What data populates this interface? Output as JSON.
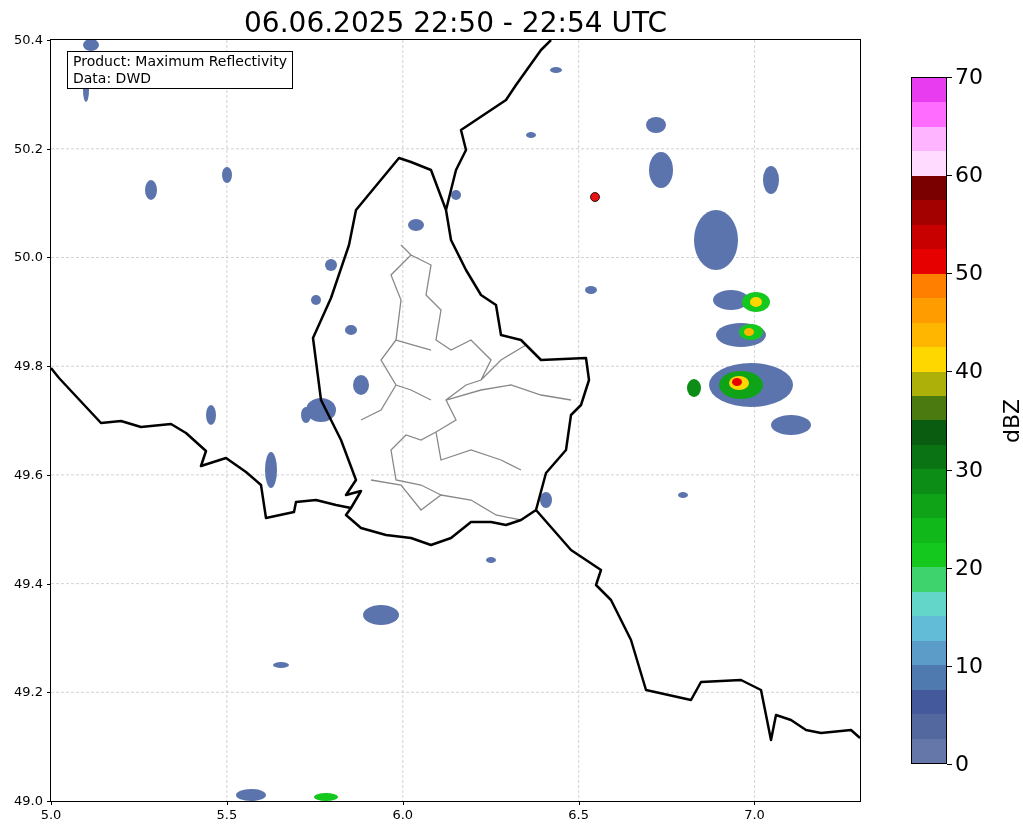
{
  "title": "06.06.2025 22:50 - 22:54 UTC",
  "legend": [
    "Product: Maximum Reflectivity",
    "Data: DWD"
  ],
  "x_ticks": [
    "5.0",
    "5.5",
    "6.0",
    "6.5",
    "7.0"
  ],
  "y_ticks": [
    "50.4",
    "50.2",
    "50.0",
    "49.8",
    "49.6",
    "49.4",
    "49.2",
    "49.0"
  ],
  "colorbar": {
    "label": "dBZ",
    "ticks": [
      "70",
      "60",
      "50",
      "40",
      "30",
      "20",
      "10",
      "0"
    ],
    "bands": [
      {
        "color": "#6577a8"
      },
      {
        "color": "#5468a0"
      },
      {
        "color": "#44599c"
      },
      {
        "color": "#4e7ab0"
      },
      {
        "color": "#5b9cc8"
      },
      {
        "color": "#62bcd8"
      },
      {
        "color": "#63d6c9"
      },
      {
        "color": "#3fd36e"
      },
      {
        "color": "#14c81e"
      },
      {
        "color": "#10b81a"
      },
      {
        "color": "#0fa418"
      },
      {
        "color": "#0c8e16"
      },
      {
        "color": "#0a7414"
      },
      {
        "color": "#095c10"
      },
      {
        "color": "#4a7a10"
      },
      {
        "color": "#aeb00a"
      },
      {
        "color": "#ffd700"
      },
      {
        "color": "#ffb600"
      },
      {
        "color": "#ff9c00"
      },
      {
        "color": "#ff7f00"
      },
      {
        "color": "#e60000"
      },
      {
        "color": "#c80000"
      },
      {
        "color": "#a30000"
      },
      {
        "color": "#7a0000"
      },
      {
        "color": "#ffdcff"
      },
      {
        "color": "#ffb4ff"
      },
      {
        "color": "#ff6cff"
      },
      {
        "color": "#e83cf0"
      }
    ]
  }
}
